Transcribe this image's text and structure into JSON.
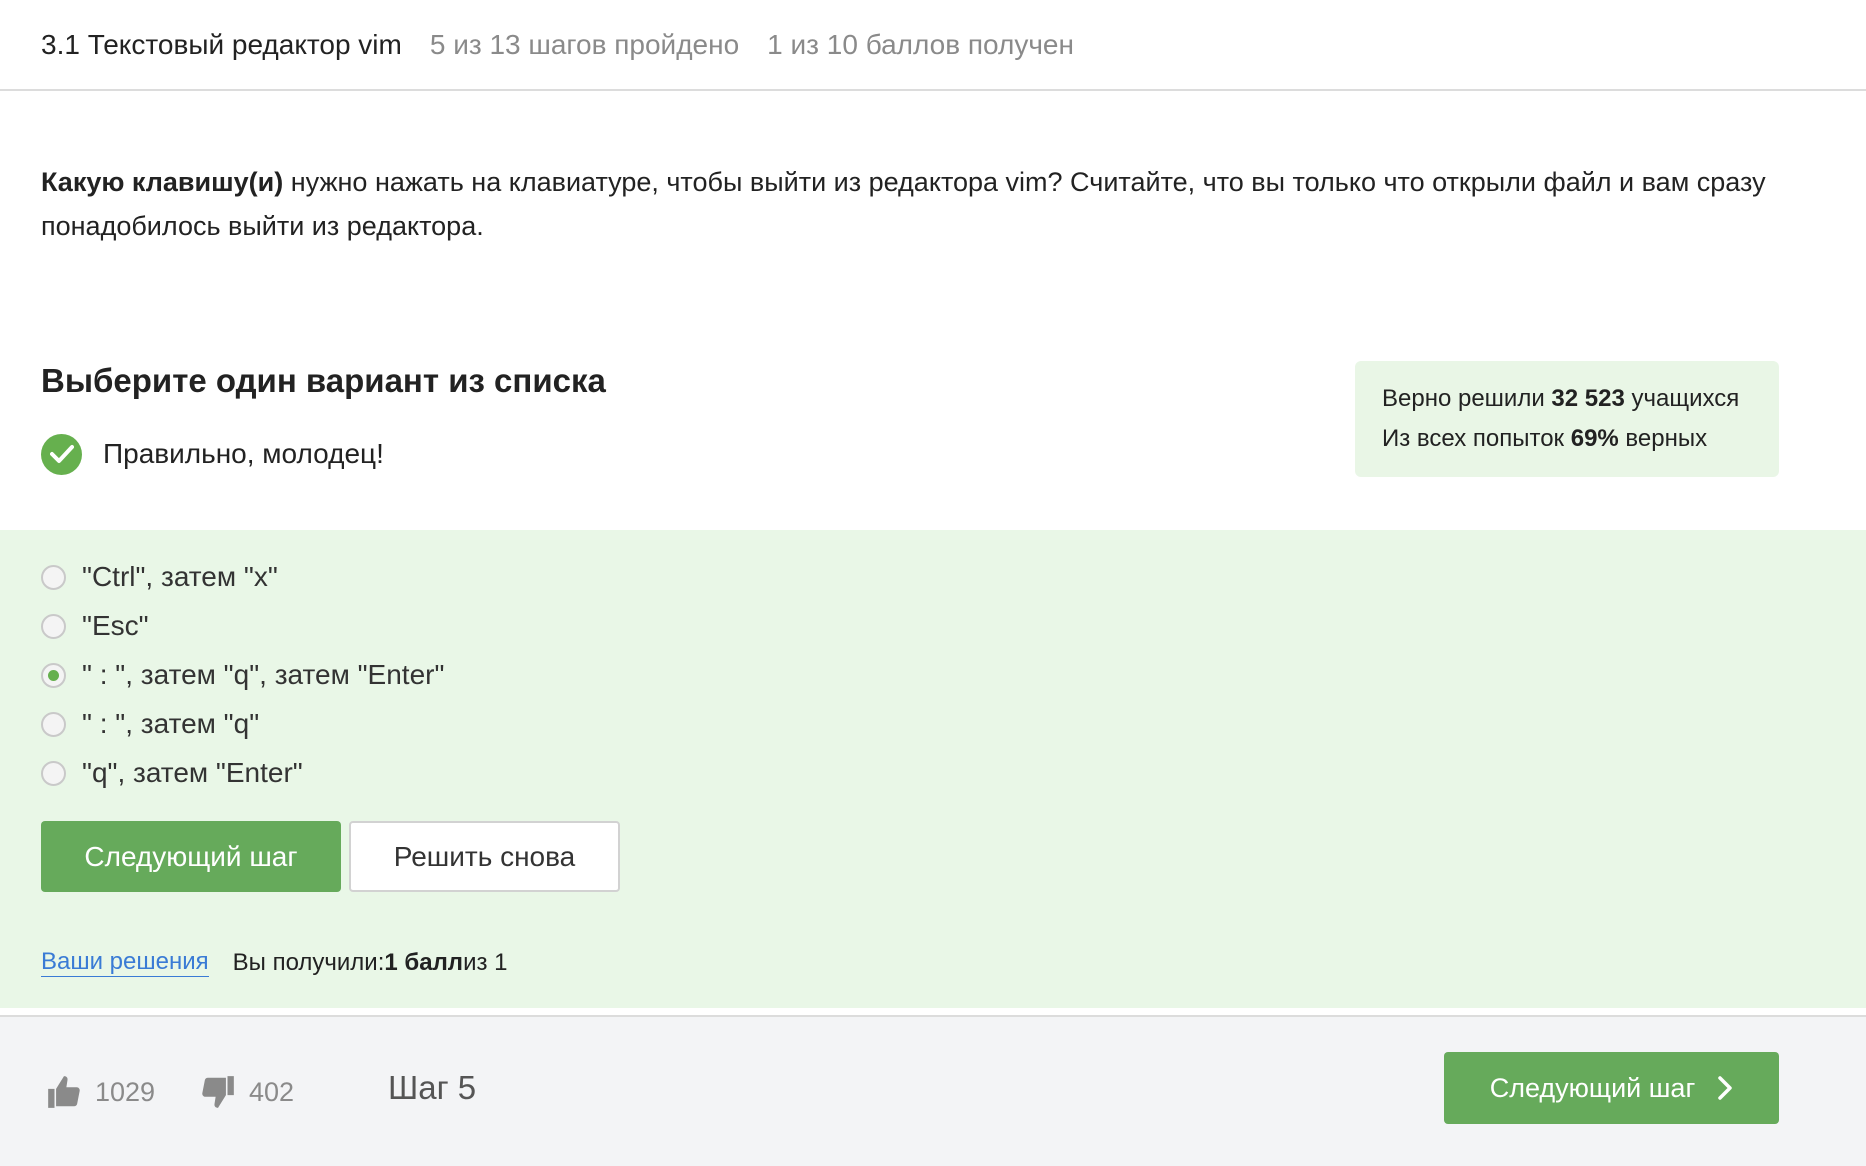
{
  "header": {
    "title": "3.1 Текстовый редактор vim",
    "steps_progress": "5 из 13 шагов пройдено",
    "points_progress": "1 из 10 баллов  получен"
  },
  "question": {
    "bold_part": "Какую клавишу(и)",
    "rest": " нужно нажать на клавиатуре, чтобы выйти из редактора vim? Считайте, что вы только что открыли файл и вам сразу понадобилось выйти из редактора."
  },
  "choose": {
    "title": "Выберите один вариант из списка",
    "feedback": "Правильно, молодец!"
  },
  "stats": {
    "line1_prefix": "Верно решили ",
    "line1_value": "32 523",
    "line1_suffix": " учащихся",
    "line2_prefix": "Из всех попыток ",
    "line2_value": "69%",
    "line2_suffix": " верных"
  },
  "options": [
    {
      "label": "\"Ctrl\", затем \"x\"",
      "selected": false
    },
    {
      "label": "\"Esc\"",
      "selected": false
    },
    {
      "label": "\" : \", затем \"q\", затем \"Enter\"",
      "selected": true
    },
    {
      "label": "\" : \", затем \"q\"",
      "selected": false
    },
    {
      "label": "\"q\", затем \"Enter\"",
      "selected": false
    }
  ],
  "actions": {
    "next_step": "Следующий шаг",
    "retry": "Решить снова"
  },
  "result": {
    "link": "Ваши решения",
    "prefix": "Вы получили: ",
    "score": "1 балл",
    "suffix": " из 1"
  },
  "footer": {
    "likes": "1029",
    "dislikes": "402",
    "step": "Шаг 5",
    "next_button": "Следующий шаг"
  },
  "colors": {
    "accent_green": "#66aa5b",
    "answer_bg": "#e9f7e7",
    "link_blue": "#3a7bd5"
  }
}
